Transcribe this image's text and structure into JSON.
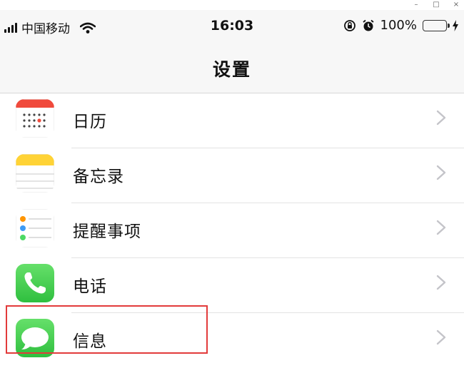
{
  "window": {
    "minimize": "–",
    "maximize": "□",
    "close": "×"
  },
  "status_bar": {
    "carrier": "中国移动",
    "time": "16:03",
    "battery_percent": "100%",
    "battery_level": 1.0
  },
  "nav": {
    "title": "设置"
  },
  "rows": [
    {
      "label": "日历",
      "icon": "calendar-icon"
    },
    {
      "label": "备忘录",
      "icon": "notes-icon"
    },
    {
      "label": "提醒事项",
      "icon": "reminders-icon"
    },
    {
      "label": "电话",
      "icon": "phone-icon"
    },
    {
      "label": "信息",
      "icon": "messages-icon"
    }
  ],
  "colors": {
    "highlight": "#e23b3b",
    "phone_green": "#4cd964",
    "battery_green": "#4cd964",
    "calendar_red": "#f04a3c",
    "notes_yellow": "#ffd336"
  }
}
